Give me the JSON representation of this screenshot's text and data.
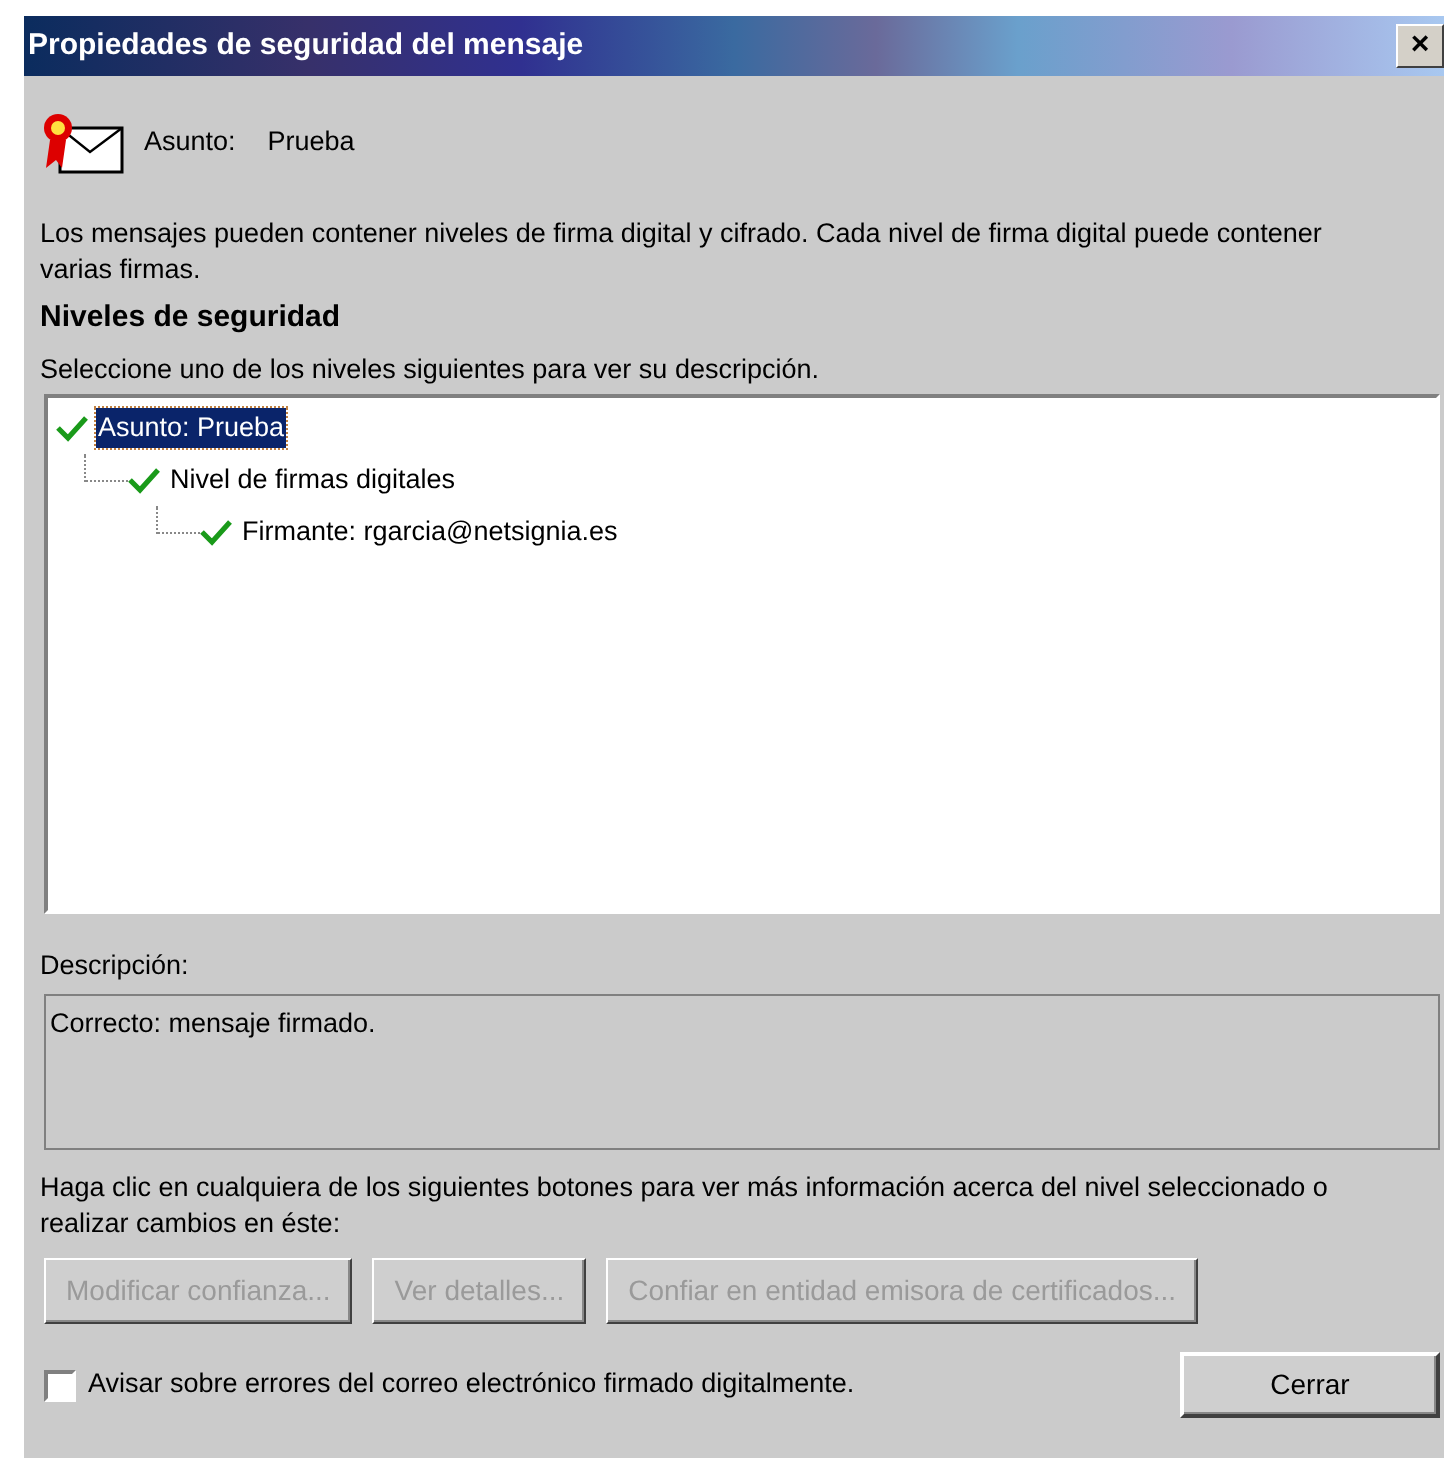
{
  "window": {
    "title": "Propiedades de seguridad del mensaje",
    "close": "×"
  },
  "subject": {
    "label": "Asunto:",
    "value": "Prueba"
  },
  "intro": "Los mensajes pueden contener niveles de firma digital y cifrado. Cada nivel de firma digital puede contener varias firmas.",
  "levels_heading": "Niveles de seguridad",
  "levels_hint": "Seleccione uno de los niveles siguientes para ver su descripción.",
  "tree": [
    {
      "label": "Asunto: Prueba",
      "valid": true,
      "selected": true,
      "children": [
        {
          "label": "Nivel de firmas digitales",
          "valid": true,
          "selected": false,
          "children": [
            {
              "label": "Firmante: rgarcia@netsignia.es",
              "valid": true,
              "selected": false
            }
          ]
        }
      ]
    }
  ],
  "description": {
    "label": "Descripción:",
    "text": "Correcto: mensaje firmado."
  },
  "buttons_hint": "Haga clic en cualquiera de los siguientes botones para ver más información acerca del nivel seleccionado o realizar cambios en éste:",
  "buttons": [
    {
      "label": "Modificar confianza...",
      "disabled": true
    },
    {
      "label": "Ver detalles...",
      "disabled": true
    },
    {
      "label": "Confiar en entidad emisora de certificados...",
      "disabled": true
    }
  ],
  "warn_checkbox": {
    "label": "Avisar sobre errores del correo electrónico firmado digitalmente.",
    "checked": false
  },
  "close_button": {
    "label": "Cerrar",
    "disabled": false
  }
}
